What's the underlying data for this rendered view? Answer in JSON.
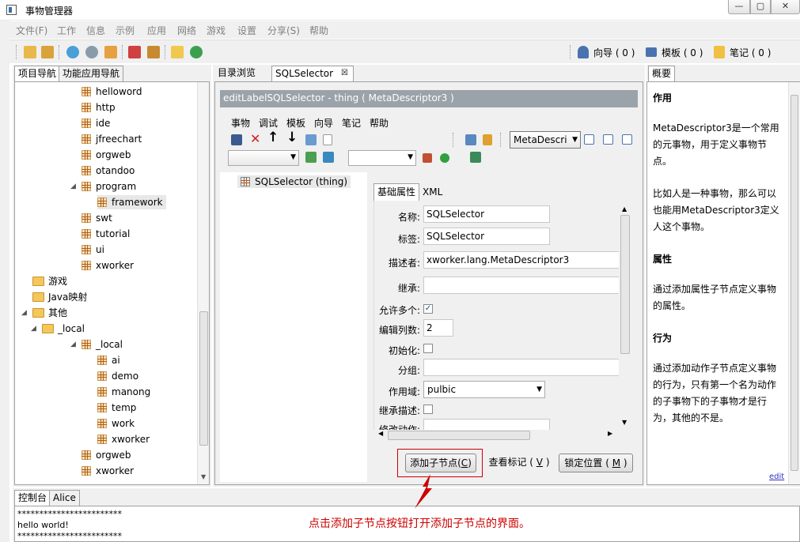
{
  "window": {
    "title": "事物管理器",
    "min": "—",
    "max": "▢",
    "close": "✕"
  },
  "menu": [
    "文件(F)",
    "工作",
    "信息",
    "示例",
    "应用",
    "网络",
    "游戏",
    "设置",
    "分享(S)",
    "帮助"
  ],
  "toolbar": {
    "guide": "向导 ( 0 )",
    "template": "模板 ( 0 )",
    "notes": "笔记 ( 0 )"
  },
  "left": {
    "tabs": [
      "项目导航",
      "功能应用导航"
    ],
    "tree": [
      {
        "label": "helloword",
        "indent": 3,
        "type": "thing"
      },
      {
        "label": "http",
        "indent": 3,
        "type": "thing"
      },
      {
        "label": "ide",
        "indent": 3,
        "type": "thing"
      },
      {
        "label": "jfreechart",
        "indent": 3,
        "type": "thing"
      },
      {
        "label": "orgweb",
        "indent": 3,
        "type": "thing"
      },
      {
        "label": "otandoo",
        "indent": 3,
        "type": "thing"
      },
      {
        "label": "program",
        "indent": 3,
        "type": "thing",
        "expanded": true
      },
      {
        "label": "framework",
        "indent": 4,
        "type": "thing",
        "selected": true
      },
      {
        "label": "swt",
        "indent": 3,
        "type": "thing"
      },
      {
        "label": "tutorial",
        "indent": 3,
        "type": "thing"
      },
      {
        "label": "ui",
        "indent": 3,
        "type": "thing"
      },
      {
        "label": "xworker",
        "indent": 3,
        "type": "thing"
      },
      {
        "label": "游戏",
        "indent": 1,
        "type": "folder"
      },
      {
        "label": "Java映射",
        "indent": 1,
        "type": "folder"
      },
      {
        "label": "其他",
        "indent": 1,
        "type": "folder",
        "expanded": true
      },
      {
        "label": "_local",
        "indent": 2,
        "type": "folder",
        "expanded": true
      },
      {
        "label": "_local",
        "indent": 3,
        "type": "thing",
        "expanded": true
      },
      {
        "label": "ai",
        "indent": 4,
        "type": "thing"
      },
      {
        "label": "demo",
        "indent": 4,
        "type": "thing"
      },
      {
        "label": "manong",
        "indent": 4,
        "type": "thing"
      },
      {
        "label": "temp",
        "indent": 4,
        "type": "thing"
      },
      {
        "label": "work",
        "indent": 4,
        "type": "thing"
      },
      {
        "label": "xworker",
        "indent": 4,
        "type": "thing"
      },
      {
        "label": "orgweb",
        "indent": 3,
        "type": "thing"
      },
      {
        "label": "xworker",
        "indent": 3,
        "type": "thing"
      }
    ]
  },
  "center": {
    "tabs": [
      "目录浏览",
      "SQLSelector"
    ],
    "tab_close": "☒",
    "editor_title": "editLabelSQLSelector - thing ( MetaDescriptor3 )",
    "editor_menu": [
      "事物",
      "调试",
      "模板",
      "向导",
      "笔记",
      "帮助"
    ],
    "descriptor_combo": "MetaDescri",
    "tree_root": "SQLSelector (thing)",
    "prop_tabs": [
      "基础属性",
      "XML"
    ],
    "fields": {
      "name_label": "名称:",
      "name_value": "SQLSelector",
      "label_label": "标签:",
      "label_value": "SQLSelector",
      "descriptor_label": "描述者:",
      "descriptor_value": "xworker.lang.MetaDescriptor3",
      "extends_label": "继承:",
      "extends_value": "",
      "many_label": "允许多个:",
      "many_checked": true,
      "cols_label": "编辑列数:",
      "cols_value": "2",
      "init_label": "初始化:",
      "group_label": "分组:",
      "group_value": "",
      "scope_label": "作用域:",
      "scope_value": "pulbic",
      "inherit_desc_label": "继承描述:",
      "modify_action_label": "修改动作:"
    },
    "buttons": {
      "add_child": "添加子节点(",
      "add_child_key": "C",
      "view_mark": "查看标记 ( ",
      "view_mark_key": "V",
      "lock_pos": "锁定位置 ( ",
      "lock_pos_key": "M",
      "close_paren": ")",
      "close_paren_sp": " )"
    }
  },
  "right": {
    "tab": "概要",
    "h1": "作用",
    "p1": "MetaDescriptor3是一个常用的元事物，用于定义事物节点。",
    "p2": "比如人是一种事物，那么可以也能用MetaDescriptor3定义人这个事物。",
    "h2": "属性",
    "p3": "通过添加属性子节点定义事物的属性。",
    "h3": "行为",
    "p4": "通过添加动作子节点定义事物的行为，只有第一个名为动作的子事物下的子事物才是行为，其他的不是。",
    "edit_link": "edit"
  },
  "bottom": {
    "tabs": [
      "控制台",
      "Alice"
    ],
    "lines": [
      "************************",
      "hello world!",
      "************************"
    ]
  },
  "annotation": "点击添加子节点按钮打开添加子节点的界面。",
  "colors": {
    "accent": "#cc0000",
    "title_bar_gray": "#9aa2aa",
    "selected": "#e8e8e8"
  }
}
